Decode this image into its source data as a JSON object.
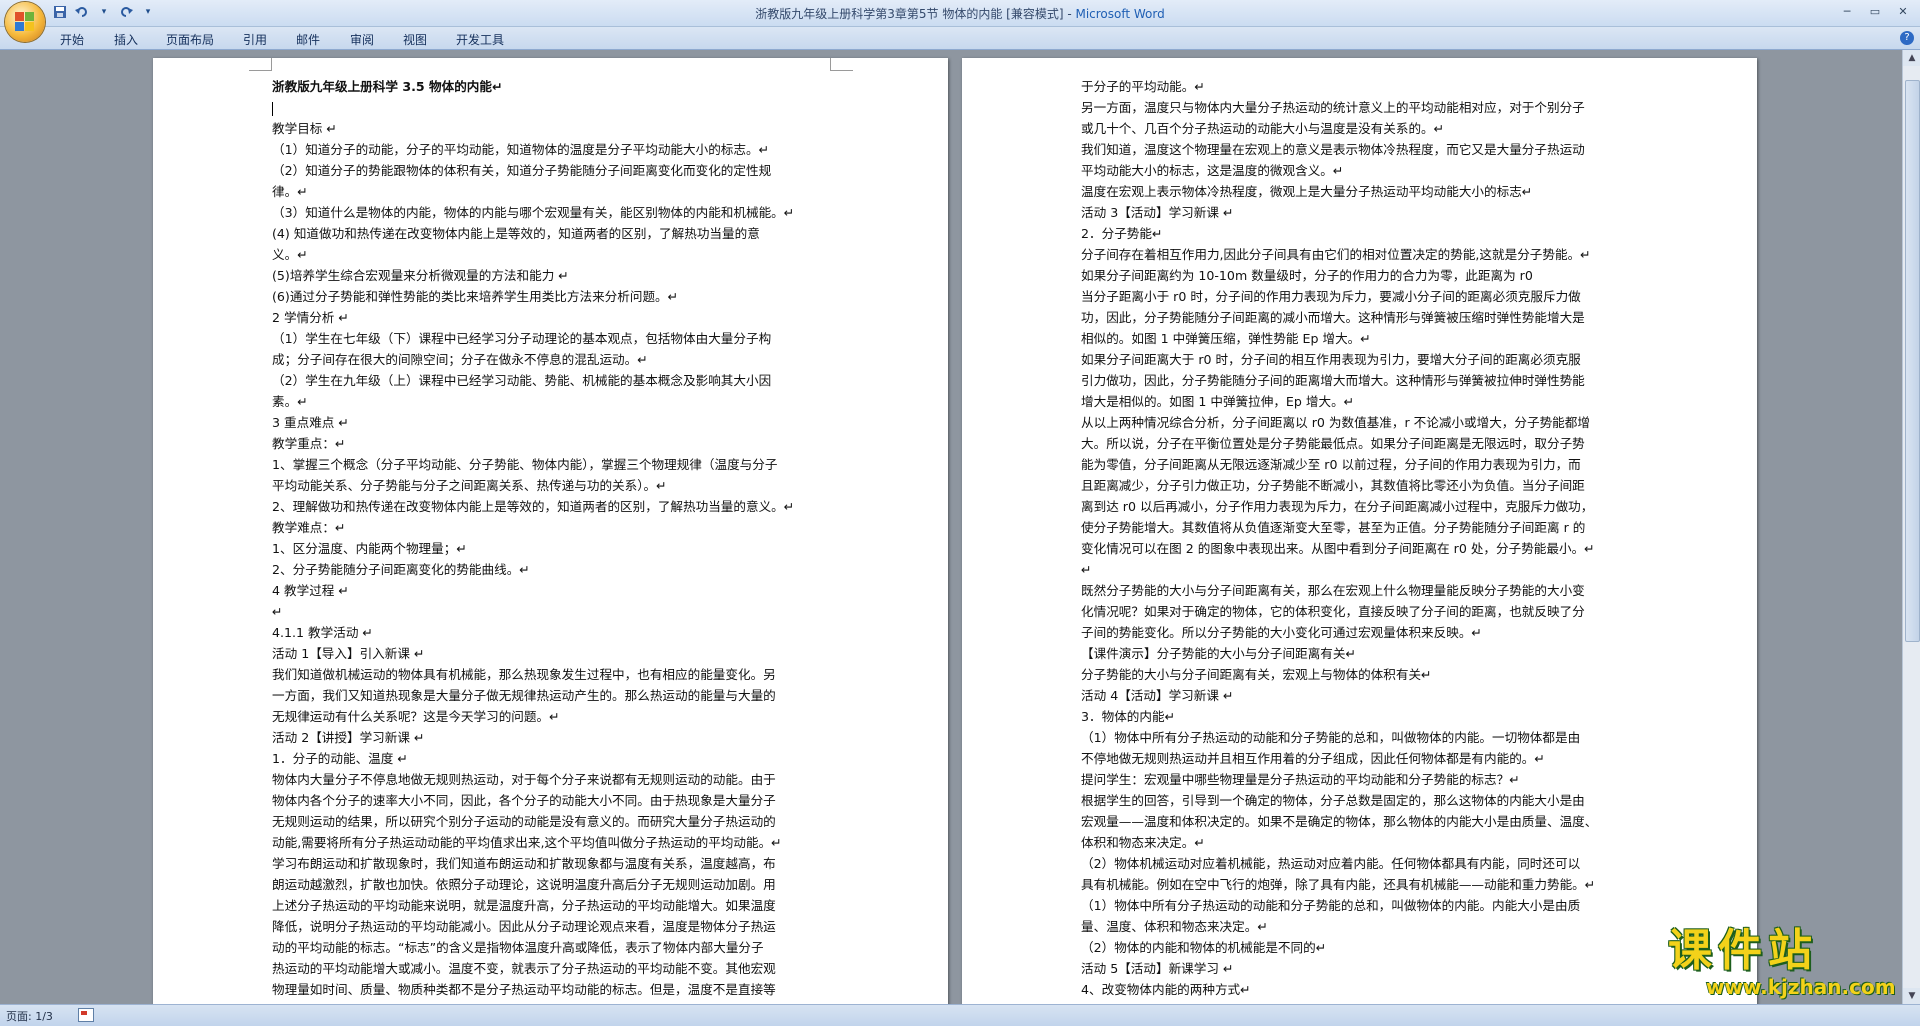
{
  "window": {
    "title_doc": "浙教版九年级上册科学第3章第5节 物体的内能 [兼容模式] - ",
    "title_app": "Microsoft Word",
    "minimize": "─",
    "maximize": "▭",
    "close": "✕"
  },
  "qat": {
    "save_icon": "save-icon",
    "undo_icon": "undo-icon",
    "redo_icon": "redo-icon",
    "customize_icon": "dropdown-icon"
  },
  "ribbon": {
    "tabs": [
      "开始",
      "插入",
      "页面布局",
      "引用",
      "邮件",
      "审阅",
      "视图",
      "开发工具"
    ],
    "help": "?"
  },
  "page1": {
    "lines": [
      "浙教版九年级上册科学 3.5 物体的内能↵",
      "",
      "教学目标 ↵",
      "（1）知道分子的动能，分子的平均动能，知道物体的温度是分子平均动能大小的标志。↵",
      "（2）知道分子的势能跟物体的体积有关，知道分子势能随分子间距离变化而变化的定性规",
      "律。↵",
      "（3）知道什么是物体的内能，物体的内能与哪个宏观量有关，能区别物体的内能和机械能。↵",
      "  (4) 知道做功和热传递在改变物体内能上是等效的，知道两者的区别，了解热功当量的意",
      "义。↵",
      "  (5)培养学生综合宏观量来分析微观量的方法和能力 ↵",
      "  (6)通过分子势能和弹性势能的类比来培养学生用类比方法来分析问题。↵",
      "2 学情分析 ↵",
      "（1）学生在七年级（下）课程中已经学习分子动理论的基本观点，包括物体由大量分子构",
      "成；分子间存在很大的间隙空间；分子在做永不停息的混乱运动。↵",
      "（2）学生在九年级（上）课程中已经学习动能、势能、机械能的基本概念及影响其大小因",
      "素。↵",
      "3 重点难点 ↵",
      "教学重点：↵",
      "1、掌握三个概念（分子平均动能、分子势能、物体内能），掌握三个物理规律（温度与分子",
      "平均动能关系、分子势能与分子之间距离关系、热传递与功的关系）。↵",
      "2、理解做功和热传递在改变物体内能上是等效的，知道两者的区别，了解热功当量的意义。↵",
      "教学难点：↵",
      "1、区分温度、内能两个物理量；↵",
      "2、分子势能随分子间距离变化的势能曲线。↵",
      "4 教学过程 ↵",
      "↵",
      "4.1.1 教学活动 ↵",
      "活动 1【导入】引入新课 ↵",
      "我们知道做机械运动的物体具有机械能，那么热现象发生过程中，也有相应的能量变化。另",
      "一方面，我们又知道热现象是大量分子做无规律热运动产生的。那么热运动的能量与大量的",
      "无规律运动有什么关系呢？这是今天学习的问题。↵",
      "活动 2【讲授】学习新课 ↵",
      "1．分子的动能、温度 ↵",
      "物体内大量分子不停息地做无规则热运动，对于每个分子来说都有无规则运动的动能。由于",
      "物体内各个分子的速率大小不同，因此，各个分子的动能大小不同。由于热现象是大量分子",
      "无规则运动的结果，所以研究个别分子运动的动能是没有意义的。而研究大量分子热运动的",
      "动能,需要将所有分子热运动动能的平均值求出来,这个平均值叫做分子热运动的平均动能。↵",
      "学习布朗运动和扩散现象时，我们知道布朗运动和扩散现象都与温度有关系，温度越高，布",
      "朗运动越激烈，扩散也加快。依照分子动理论，这说明温度升高后分子无规则运动加剧。用",
      "上述分子热运动的平均动能来说明，就是温度升高，分子热运动的平均动能增大。如果温度",
      "降低，说明分子热运动的平均动能减小。因此从分子动理论观点来看，温度是物体分子热运",
      "动的平均动能的标志。“标志”的含义是指物体温度升高或降低，表示了物体内部大量分子",
      "热运动的平均动能增大或减小。温度不变，就表示了分子热运动的平均动能不变。其他宏观",
      "物理量如时间、质量、物质种类都不是分子热运动平均动能的标志。但是，温度不是直接等"
    ]
  },
  "page2": {
    "lines": [
      "于分子的平均动能。↵",
      "另一方面，温度只与物体内大量分子热运动的统计意义上的平均动能相对应，对于个别分子",
      "或几十个、几百个分子热运动的动能大小与温度是没有关系的。↵",
      "我们知道，温度这个物理量在宏观上的意义是表示物体冷热程度，而它又是大量分子热运动",
      "平均动能大小的标志，这是温度的微观含义。↵",
      "温度在宏观上表示物体冷热程度，微观上是大量分子热运动平均动能大小的标志↵",
      "活动 3【活动】学习新课 ↵",
      "2．分子势能↵",
      "分子间存在着相互作用力,因此分子间具有由它们的相对位置决定的势能,这就是分子势能。↵",
      "如果分子间距离约为 10-10m 数量级时，分子的作用力的合力为零，此距离为 r0 ",
      "当分子距离小于 r0 时，分子间的作用力表现为斥力，要减小分子间的距离必须克服斥力做",
      "功，因此，分子势能随分子间距离的减小而增大。这种情形与弹簧被压缩时弹性势能增大是",
      "相似的。如图 1 中弹簧压缩，弹性势能 Ep 增大。↵",
      "如果分子间距离大于 r0 时，分子间的相互作用表现为引力，要增大分子间的距离必须克服",
      "引力做功，因此，分子势能随分子间的距离增大而增大。这种情形与弹簧被拉伸时弹性势能",
      "增大是相似的。如图 1 中弹簧拉伸，Ep 增大。↵",
      "从以上两种情况综合分析，分子间距离以 r0 为数值基准，r 不论减小或增大，分子势能都增",
      "大。所以说，分子在平衡位置处是分子势能最低点。如果分子间距离是无限远时，取分子势",
      "能为零值，分子间距离从无限远逐渐减少至 r0 以前过程，分子间的作用力表现为引力，而",
      "且距离减少，分子引力做正功，分子势能不断减小，其数值将比零还小为负值。当分子间距",
      "离到达 r0 以后再减小，分子作用力表现为斥力，在分子间距离减小过程中，克服斥力做功，",
      "使分子势能增大。其数值将从负值逐渐变大至零，甚至为正值。分子势能随分子间距离 r 的",
      "变化情况可以在图 2 的图象中表现出来。从图中看到分子间距离在 r0 处，分子势能最小。↵",
      "                    ↵",
      "既然分子势能的大小与分子间距离有关，那么在宏观上什么物理量能反映分子势能的大小变",
      "化情况呢？如果对于确定的物体，它的体积变化，直接反映了分子间的距离，也就反映了分",
      "子间的势能变化。所以分子势能的大小变化可通过宏观量体积来反映。↵",
      "【课件演示】分子势能的大小与分子间距离有关↵",
      "分子势能的大小与分子间距离有关，宏观上与物体的体积有关↵",
      "活动 4【活动】学习新课 ↵",
      "3．物体的内能↵",
      "（1）物体中所有分子热运动的动能和分子势能的总和，叫做物体的内能。一切物体都是由",
      "不停地做无规则热运动并且相互作用着的分子组成，因此任何物体都是有内能的。↵",
      "提问学生：宏观量中哪些物理量是分子热运动的平均动能和分子势能的标志？↵",
      "根据学生的回答，引导到一个确定的物体，分子总数是固定的，那么这物体的内能大小是由",
      "宏观量——温度和体积决定的。如果不是确定的物体，那么物体的内能大小是由质量、温度、",
      "体积和物态来决定。↵",
      "（2）物体机械运动对应着机械能，热运动对应着内能。任何物体都具有内能，同时还可以",
      "具有机械能。例如在空中飞行的炮弹，除了具有内能，还具有机械能——动能和重力势能。↵",
      "（1）物体中所有分子热运动的动能和分子势能的总和，叫做物体的内能。内能大小是由质",
      "量、温度、体积和物态来决定。↵",
      "（2）物体的内能和物体的机械能是不同的↵",
      "活动 5【活动】新课学习 ↵",
      "4、改变物体内能的两种方式↵"
    ]
  },
  "status": {
    "page": "页面: 1/3"
  },
  "watermark": {
    "big": "课件站",
    "small": "www.kjzhan.com"
  }
}
